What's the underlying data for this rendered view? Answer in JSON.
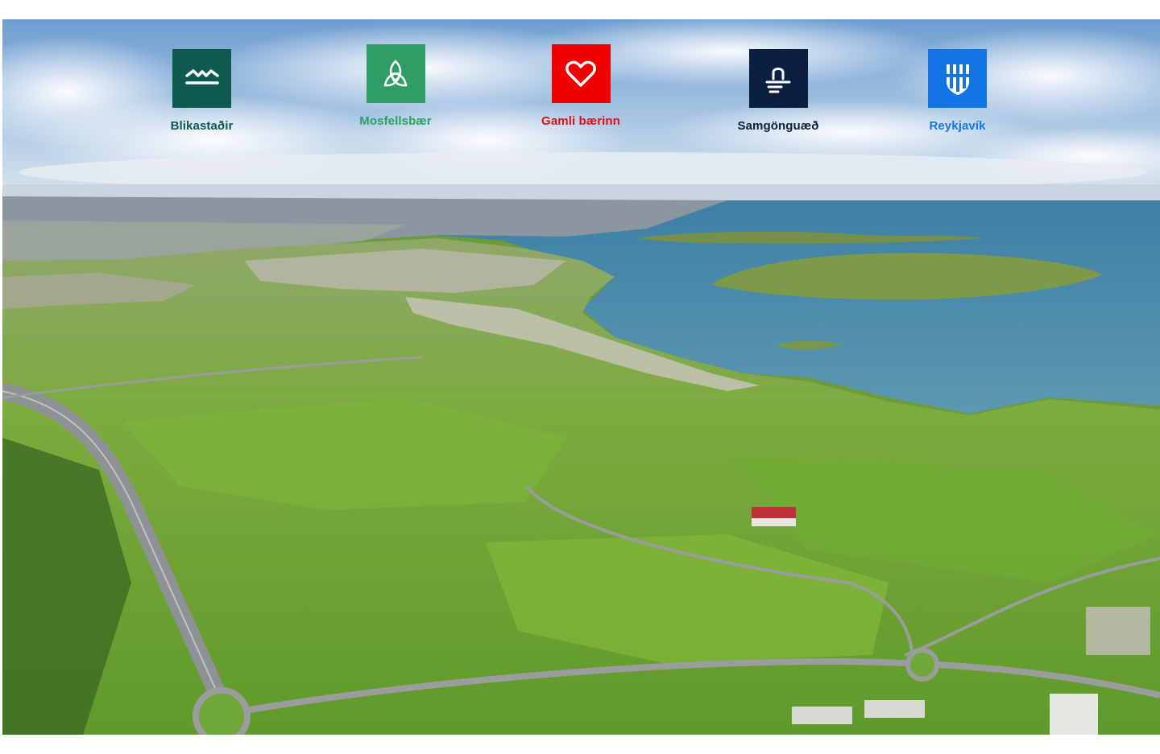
{
  "hero": {
    "image_alt": "aerial-landscape-photo"
  },
  "logos": [
    {
      "label": "Blikastaðir",
      "icon": "waves-icon",
      "tile_color": "#0e5a4f",
      "label_color": "#0e5a4f"
    },
    {
      "label": "Mosfellsbær",
      "icon": "triquetra-icon",
      "tile_color": "#2e9e66",
      "label_color": "#2e9e66"
    },
    {
      "label": "Gamli bærinn",
      "icon": "heart-icon",
      "tile_color": "#f00000",
      "label_color": "#e0101a"
    },
    {
      "label": "Samgönguæð",
      "icon": "transit-line-icon",
      "tile_color": "#0b1f40",
      "label_color": "#0b1f40"
    },
    {
      "label": "Reykjavík",
      "icon": "reykjavik-shield-icon",
      "tile_color": "#1275e3",
      "label_color": "#1275e3"
    }
  ]
}
